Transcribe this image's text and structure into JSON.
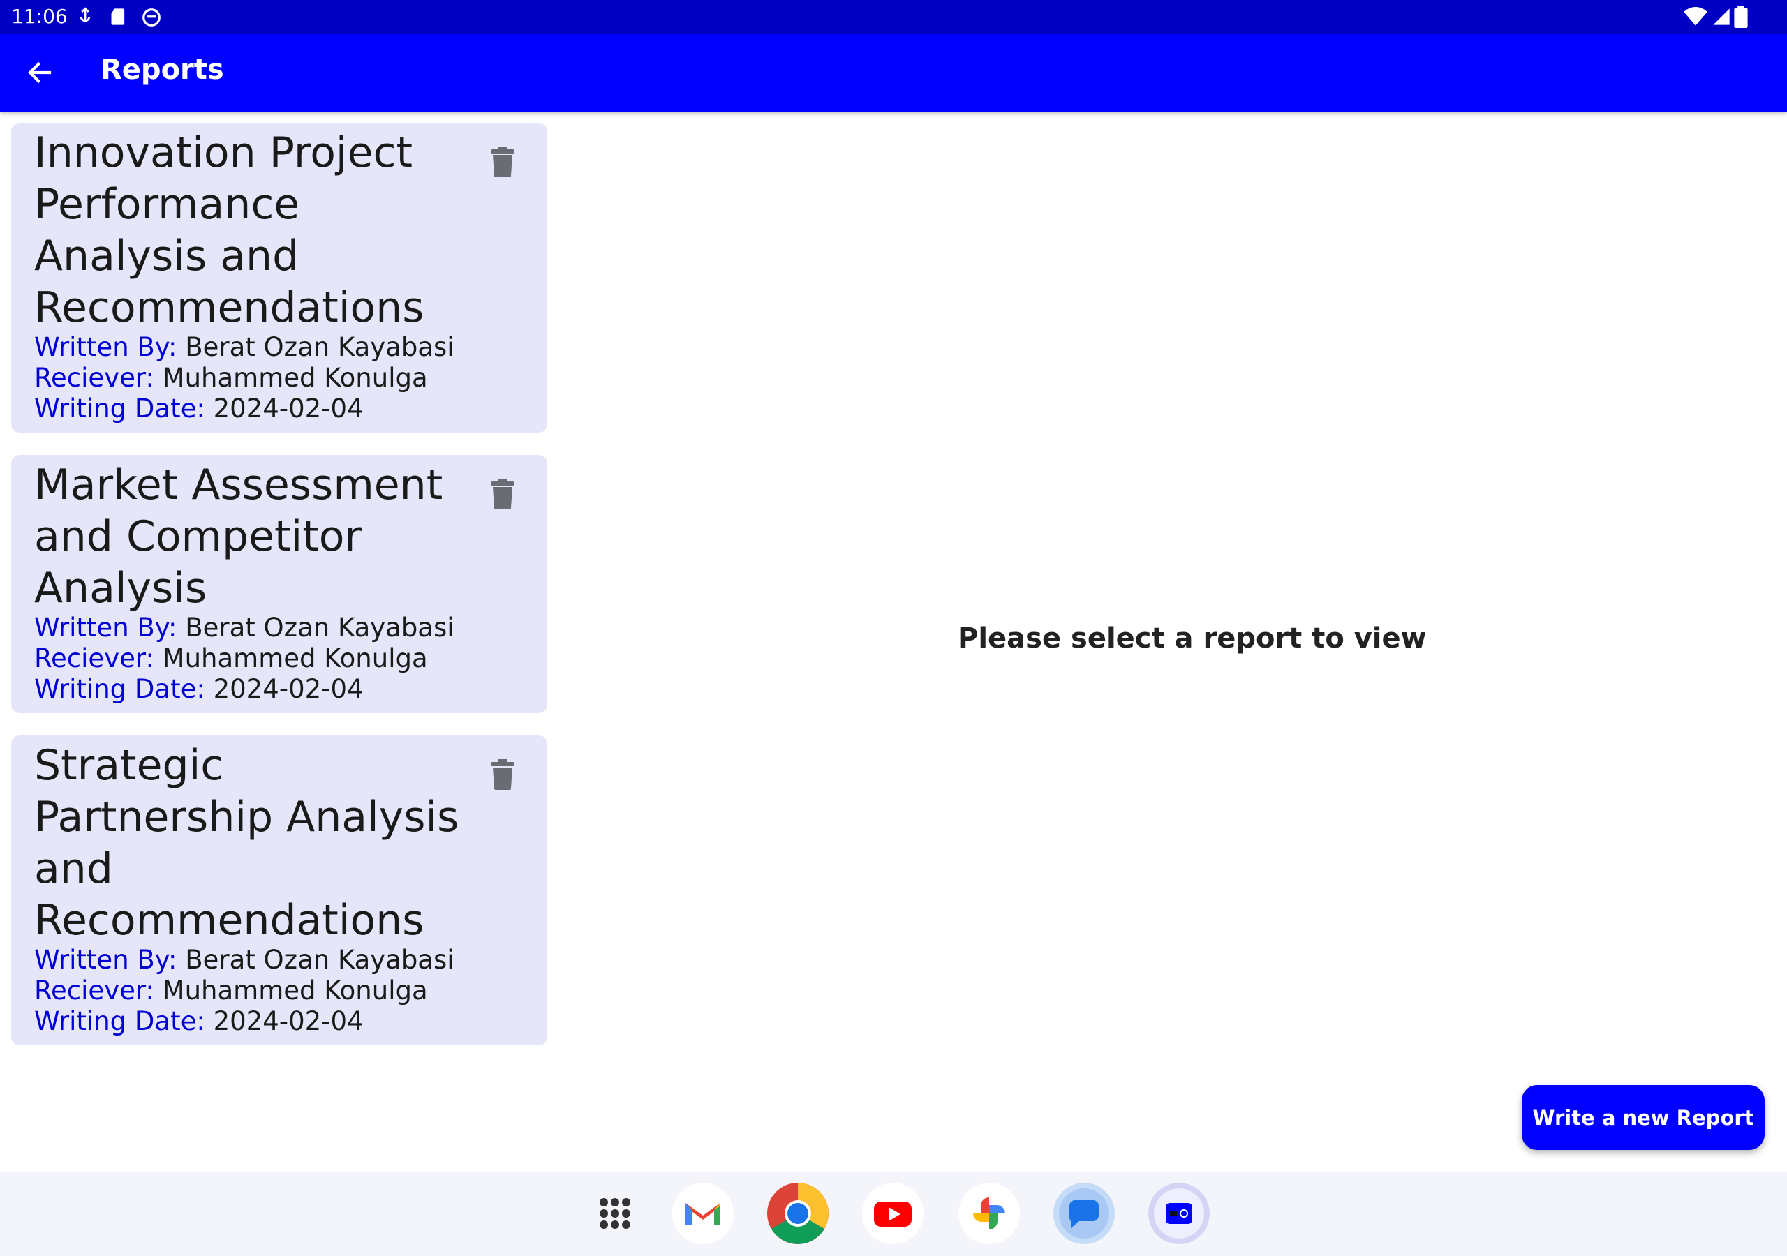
{
  "status_bar": {
    "time": "11:06"
  },
  "app_bar": {
    "title": "Reports"
  },
  "reports": [
    {
      "title": "Innovation Project Performance Analysis and Recommendations",
      "written_by_label": "Written By:",
      "written_by": "Berat Ozan Kayabasi",
      "receiver_label": "Reciever:",
      "receiver": "Muhammed Konulga",
      "date_label": "Writing Date:",
      "date": "2024-02-04"
    },
    {
      "title": "Market Assessment and Competitor Analysis",
      "written_by_label": "Written By:",
      "written_by": "Berat Ozan Kayabasi",
      "receiver_label": "Reciever:",
      "receiver": "Muhammed Konulga",
      "date_label": "Writing Date:",
      "date": "2024-02-04"
    },
    {
      "title": "Strategic Partnership Analysis and Recommendations",
      "written_by_label": "Written By:",
      "written_by": "Berat Ozan Kayabasi",
      "receiver_label": "Reciever:",
      "receiver": "Muhammed Konulga",
      "date_label": "Writing Date:",
      "date": "2024-02-04"
    }
  ],
  "detail_placeholder": "Please select a report to view",
  "fab": {
    "label": "Write a new Report"
  },
  "dock": {
    "apps": [
      "app-drawer",
      "gmail",
      "chrome",
      "youtube",
      "photos",
      "messages",
      "report-app"
    ]
  },
  "colors": {
    "status_bar": "#0000c4",
    "app_bar": "#0000ff",
    "card_bg": "#e6e6fa",
    "label_blue": "#0000d6",
    "fab": "#0000ff"
  }
}
